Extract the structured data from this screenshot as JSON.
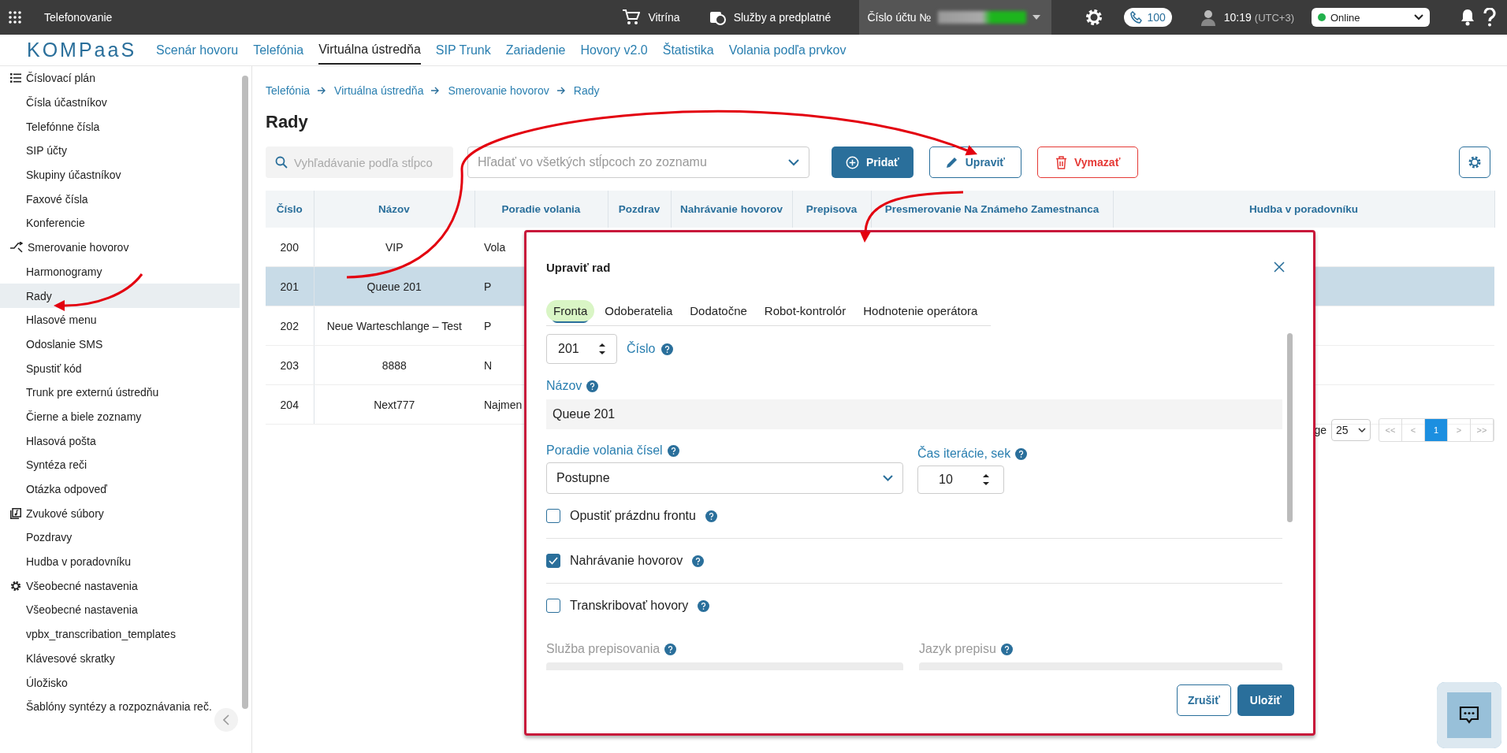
{
  "topbar": {
    "app_title": "Telefonovanie",
    "shop": "Vitrína",
    "services": "Služby a predplatné",
    "account_label": "Číslo účtu №",
    "calls_badge": "100",
    "time": "10:19",
    "timezone": "(UTC+3)",
    "status": {
      "label": "Online",
      "color": "#22b14c"
    }
  },
  "nav": {
    "logo": "KOMPaaS",
    "items": [
      {
        "label": "Scenár hovoru",
        "selected": false
      },
      {
        "label": "Telefónia",
        "selected": false
      },
      {
        "label": "Virtuálna ústredňa",
        "selected": true
      },
      {
        "label": "SIP Trunk",
        "selected": false
      },
      {
        "label": "Zariadenie",
        "selected": false
      },
      {
        "label": "Hovory v2.0",
        "selected": false
      },
      {
        "label": "Štatistika",
        "selected": false
      },
      {
        "label": "Volania podľa prvkov",
        "selected": false
      }
    ]
  },
  "sidebar": {
    "groups": [
      {
        "kind": "list",
        "label": "Číslovací plán",
        "children": [
          {
            "label": "Čísla účastníkov",
            "selected": false
          },
          {
            "label": "Telefónne čísla",
            "selected": false
          },
          {
            "label": "SIP účty",
            "selected": false
          },
          {
            "label": "Skupiny účastníkov",
            "selected": false
          },
          {
            "label": "Faxové čísla",
            "selected": false
          },
          {
            "label": "Konferencie",
            "selected": false
          }
        ]
      },
      {
        "kind": "routing",
        "label": "Smerovanie hovorov",
        "children": [
          {
            "label": "Harmonogramy",
            "selected": false
          },
          {
            "label": "Rady",
            "selected": true
          },
          {
            "label": "Hlasové menu",
            "selected": false
          },
          {
            "label": "Odoslanie SMS",
            "selected": false
          },
          {
            "label": "Spustiť kód",
            "selected": false
          },
          {
            "label": "Trunk pre externú ústredňu",
            "selected": false
          },
          {
            "label": "Čierne a biele zoznamy",
            "selected": false
          },
          {
            "label": "Hlasová pošta",
            "selected": false
          },
          {
            "label": "Syntéza reči",
            "selected": false
          },
          {
            "label": "Otázka odpoveď",
            "selected": false
          }
        ]
      },
      {
        "kind": "sound",
        "label": "Zvukové súbory",
        "children": [
          {
            "label": "Pozdravy",
            "selected": false
          },
          {
            "label": "Hudba v poradovníku",
            "selected": false
          }
        ]
      },
      {
        "kind": "settings",
        "label": "Všeobecné nastavenia",
        "children": [
          {
            "label": "Všeobecné nastavenia",
            "selected": false
          },
          {
            "label": "vpbx_transcribation_templates",
            "selected": false
          },
          {
            "label": "Klávesové skratky",
            "selected": false
          },
          {
            "label": "Úložisko",
            "selected": false
          },
          {
            "label": "Šablóny syntézy a rozpoznávania reč.",
            "selected": false
          }
        ]
      }
    ]
  },
  "breadcrumb": [
    "Telefónia",
    "Virtuálna ústredňa",
    "Smerovanie hovorov",
    "Rady"
  ],
  "page_title": "Rady",
  "toolbar": {
    "search": {
      "placeholder": "Vyhľadávanie podľa stĺpco"
    },
    "column_select": {
      "placeholder": "Hľadať vo všetkých stĺpcoch zo zoznamu"
    },
    "buttons": [
      {
        "kind": "add",
        "label": "Pridať"
      },
      {
        "kind": "edit",
        "label": "Upraviť"
      },
      {
        "kind": "delete",
        "label": "Vymazať"
      }
    ]
  },
  "table": {
    "columns": [
      "Číslo",
      "Názov",
      "Poradie volania",
      "Pozdrav",
      "Nahrávanie hovorov",
      "Prepisova",
      "Presmerovanie Na Známeho Zamestnanca",
      "Hudba v poradovníku"
    ],
    "rows": [
      {
        "cells": [
          "200",
          "VIP",
          "Vola"
        ],
        "selected": false
      },
      {
        "cells": [
          "201",
          "Queue 201",
          "P"
        ],
        "selected": true
      },
      {
        "cells": [
          "202",
          "Neue Warteschlange – Test",
          "P"
        ],
        "selected": false
      },
      {
        "cells": [
          "203",
          "8888",
          "N"
        ],
        "selected": false
      },
      {
        "cells": [
          "204",
          "Next777",
          "Najmen"
        ],
        "selected": false
      }
    ]
  },
  "pagination": {
    "label": "ge",
    "page_size": "25",
    "buttons": [
      {
        "label": "<<",
        "selected": false
      },
      {
        "label": "<",
        "selected": false
      },
      {
        "label": "1",
        "selected": true
      },
      {
        "label": ">",
        "selected": false
      },
      {
        "label": ">>",
        "selected": false
      }
    ]
  },
  "dialog": {
    "title": "Upraviť rad",
    "tabs": [
      {
        "label": "Fronta",
        "selected": true
      },
      {
        "label": "Odoberatelia",
        "selected": false
      },
      {
        "label": "Dodatočne",
        "selected": false
      },
      {
        "label": "Robot-kontrolór",
        "selected": false
      },
      {
        "label": "Hodnotenie operátora",
        "selected": false
      }
    ],
    "number": {
      "value": "201",
      "label": "Číslo"
    },
    "name": {
      "label": "Názov",
      "value": "Queue 201"
    },
    "order": {
      "label": "Poradie volania čísel",
      "value": "Postupne"
    },
    "iteration": {
      "label": "Čas iterácie, sek",
      "value": "10"
    },
    "checkboxes": [
      {
        "label": "Opustiť prázdnu frontu",
        "checked": false
      },
      {
        "label": "Nahrávanie hovorov",
        "checked": true
      },
      {
        "label": "Transkribovať hovory",
        "checked": false
      }
    ],
    "transcription_fields": [
      {
        "label": "Služba prepisovania",
        "disabled": true
      },
      {
        "label": "Jazyk prepisu",
        "disabled": true
      }
    ],
    "buttons": [
      {
        "kind": "cancel",
        "label": "Zrušiť"
      },
      {
        "kind": "save",
        "label": "Uložiť"
      }
    ]
  }
}
